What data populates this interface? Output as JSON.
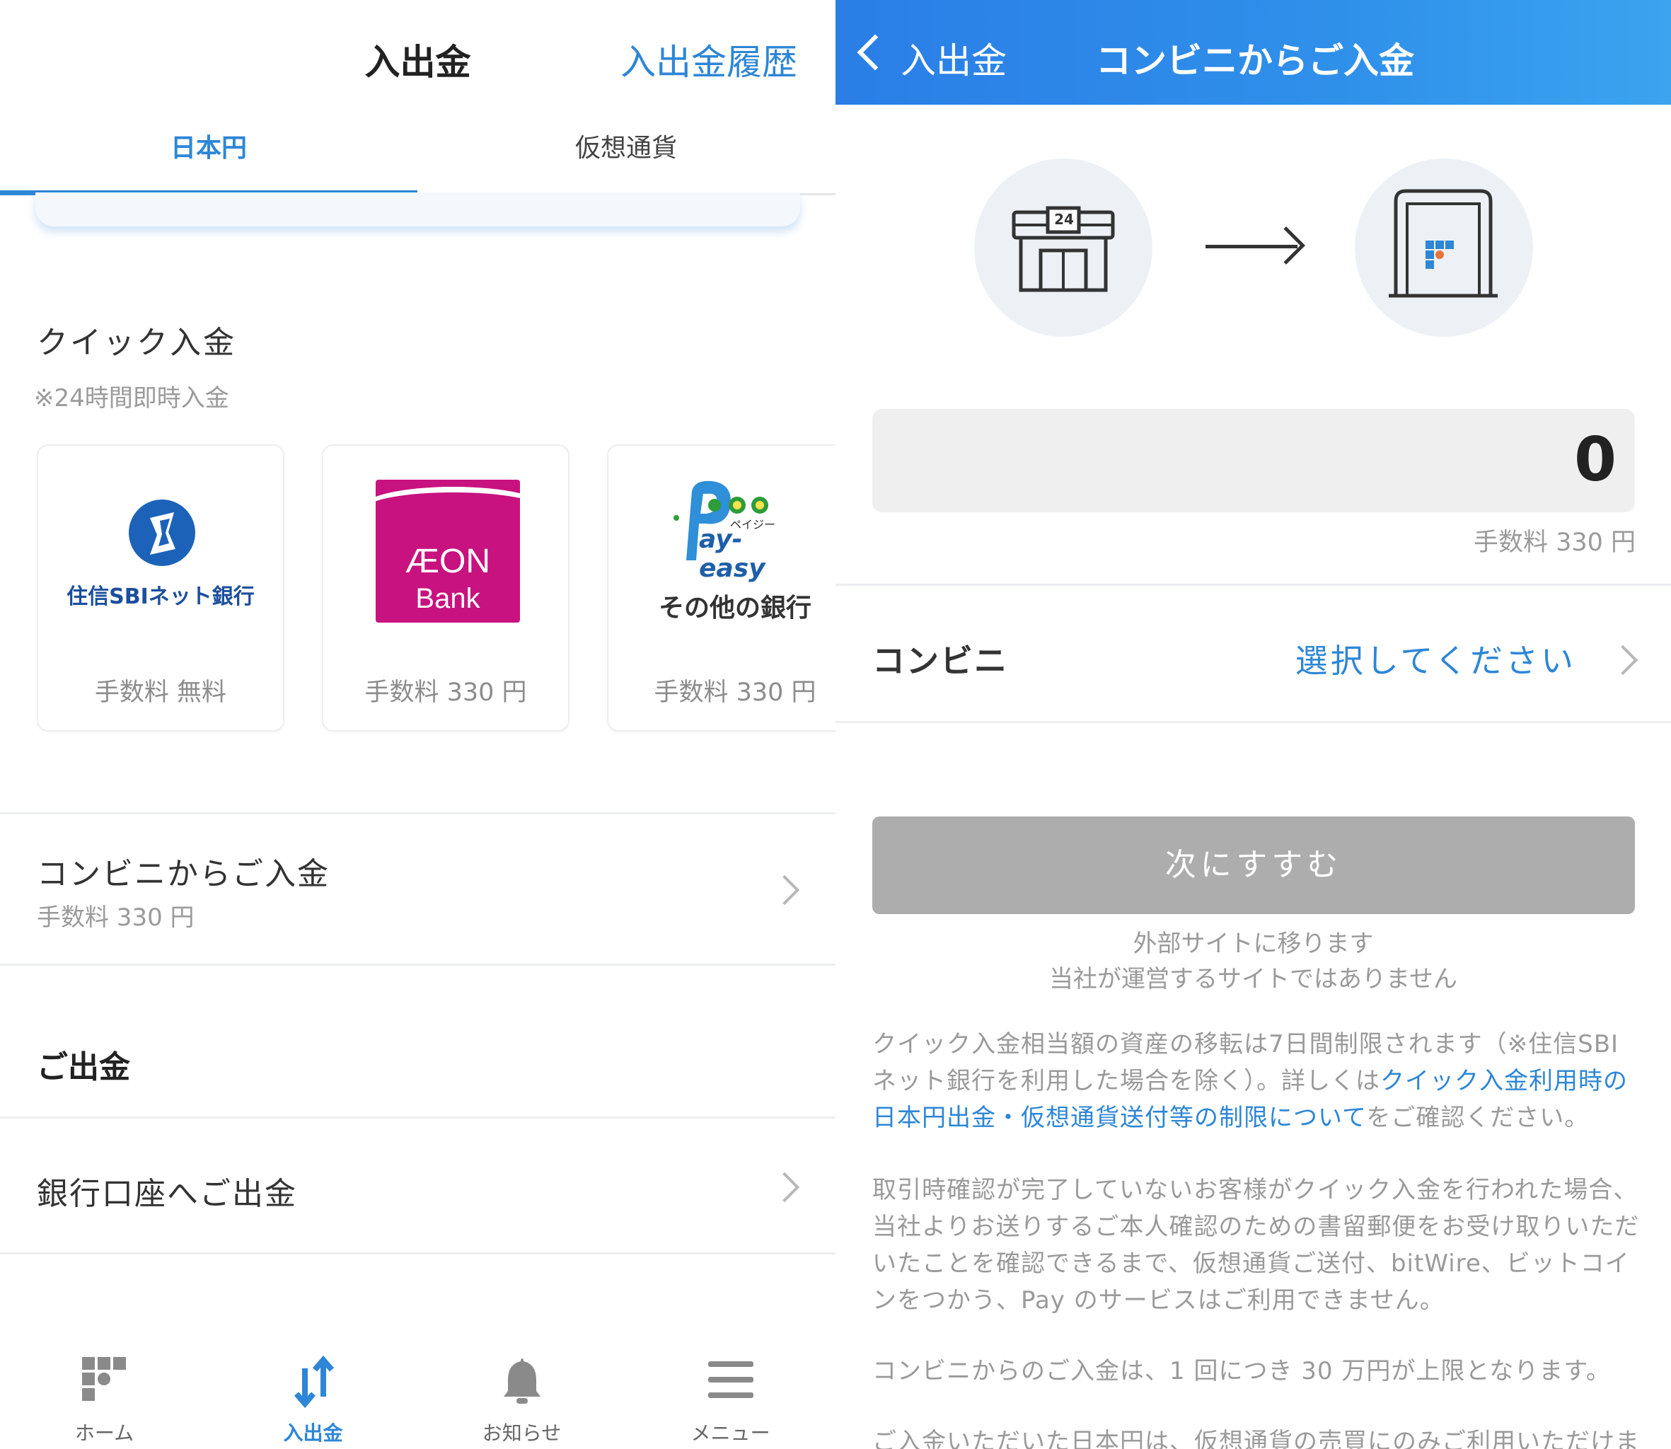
{
  "left": {
    "header": {
      "title": "入出金",
      "history_link": "入出金履歴"
    },
    "tabs": [
      {
        "label": "日本円",
        "active": true
      },
      {
        "label": "仮想通貨",
        "active": false
      }
    ],
    "quick": {
      "title": "クイック入金",
      "subtitle": "※24時間即時入金",
      "cards": [
        {
          "logo_name": "住信SBIネット銀行",
          "fee": "手数料 無料"
        },
        {
          "logo_line1": "ÆON",
          "logo_line2": "Bank",
          "fee": "手数料 330 円"
        },
        {
          "logo_name": "その他の銀行",
          "fee": "手数料 330 円",
          "logo_small": "ペイジー",
          "logo_text": "ay-easy"
        }
      ]
    },
    "convenience": {
      "title": "コンビニからご入金",
      "fee": "手数料 330 円"
    },
    "withdraw": {
      "section_title": "ご出金",
      "bank_item": "銀行口座へご出金"
    },
    "tabbar": [
      {
        "label": "ホーム",
        "icon": "home-icon",
        "active": false
      },
      {
        "label": "入出金",
        "icon": "deposit-withdraw-icon",
        "active": true
      },
      {
        "label": "お知らせ",
        "icon": "bell-icon",
        "active": false
      },
      {
        "label": "メニュー",
        "icon": "menu-icon",
        "active": false
      }
    ]
  },
  "right": {
    "header": {
      "back_label": "入出金",
      "title": "コンビニからご入金"
    },
    "illustration": {
      "store_badge": "24"
    },
    "amount": {
      "value": "0",
      "fee": "手数料 330 円"
    },
    "convenience_store": {
      "label": "コンビニ",
      "placeholder": "選択してください"
    },
    "next_button": "次にすすむ",
    "external_note": {
      "line1": "外部サイトに移ります",
      "line2": "当社が運営するサイトではありません"
    },
    "notes": {
      "p1_before": "クイック入金相当額の資産の移転は7日間制限されます（※住信SBIネット銀行を利用した場合を除く）。詳しくは",
      "p1_link": "クイック入金利用時の日本円出金・仮想通貨送付等の制限について",
      "p1_after": "をご確認ください。",
      "p2": "取引時確認が完了していないお客様がクイック入金を行われた場合、当社よりお送りするご本人確認のための書留郵便をお受け取りいただいたことを確認できるまで、仮想通貨ご送付、bitWire、ビットコインをつかう、Pay のサービスはご利用できません。",
      "p3": "コンビニからのご入金は、1 回につき 30 万円が上限となります。",
      "p4": "ご入金いただいた日本円は、仮想通貨の売買にのみご利用いただけます。"
    }
  },
  "colors": {
    "accent": "#2d86d6",
    "header_blue": "#2a7ee6",
    "aeon": "#c8127f",
    "sbi": "#1c62b9",
    "disabled_button": "#adadad"
  }
}
